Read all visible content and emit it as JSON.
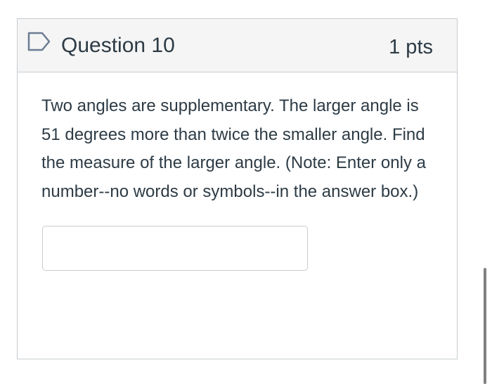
{
  "question": {
    "title": "Question 10",
    "points": "1 pts",
    "flag_icon": "flag-icon",
    "text": "Two angles are supplementary. The larger angle is 51 degrees more than twice the smaller angle. Find the measure of the larger angle. (Note: Enter only a number--no words or symbols--in the answer box.)",
    "answer": {
      "value": "",
      "placeholder": ""
    }
  },
  "colors": {
    "header_bg": "#f5f5f5",
    "border": "#c7cdd1",
    "text": "#2d3b45",
    "flag_stroke": "#6b7c93",
    "scrollbar": "#808080"
  }
}
